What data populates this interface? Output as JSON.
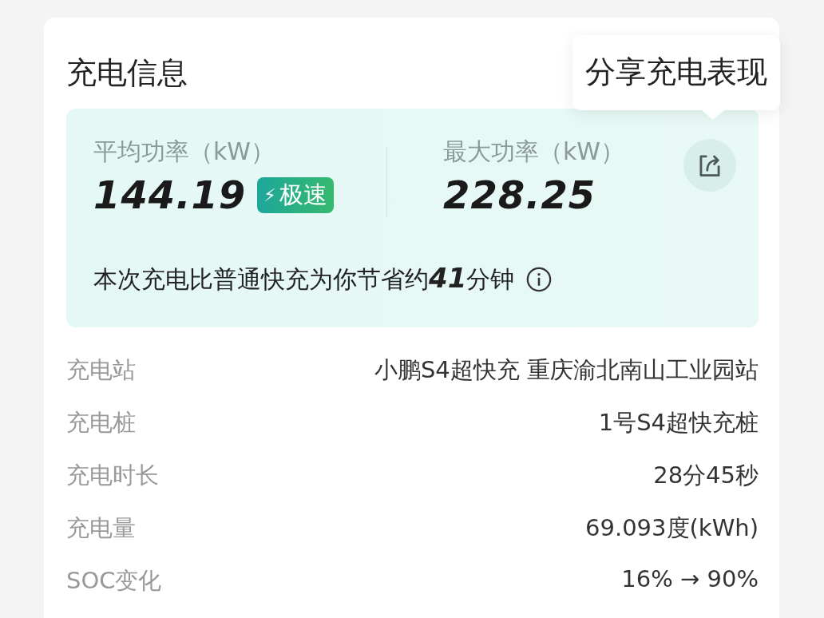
{
  "card": {
    "title": "充电信息"
  },
  "tooltip": {
    "text": "分享充电表现"
  },
  "summary": {
    "avg_label": "平均功率（kW）",
    "avg_value": "144.19",
    "badge": {
      "icon": "⚡",
      "text": "极速"
    },
    "max_label": "最大功率（kW）",
    "max_value": "228.25",
    "saving": "本次充电比普通快充为你节省约**41**分钟"
  },
  "details": [
    {
      "label": "充电站",
      "value": "小鹏S4超快充 重庆渝北南山工业园站"
    },
    {
      "label": "充电桩",
      "value": "1号S4超快充桩"
    },
    {
      "label": "充电时长",
      "value": "28分45秒"
    },
    {
      "label": "充电量",
      "value": "69.093度(kWh)"
    },
    {
      "label": "SOC变化",
      "value": "16% → 90%"
    }
  ]
}
